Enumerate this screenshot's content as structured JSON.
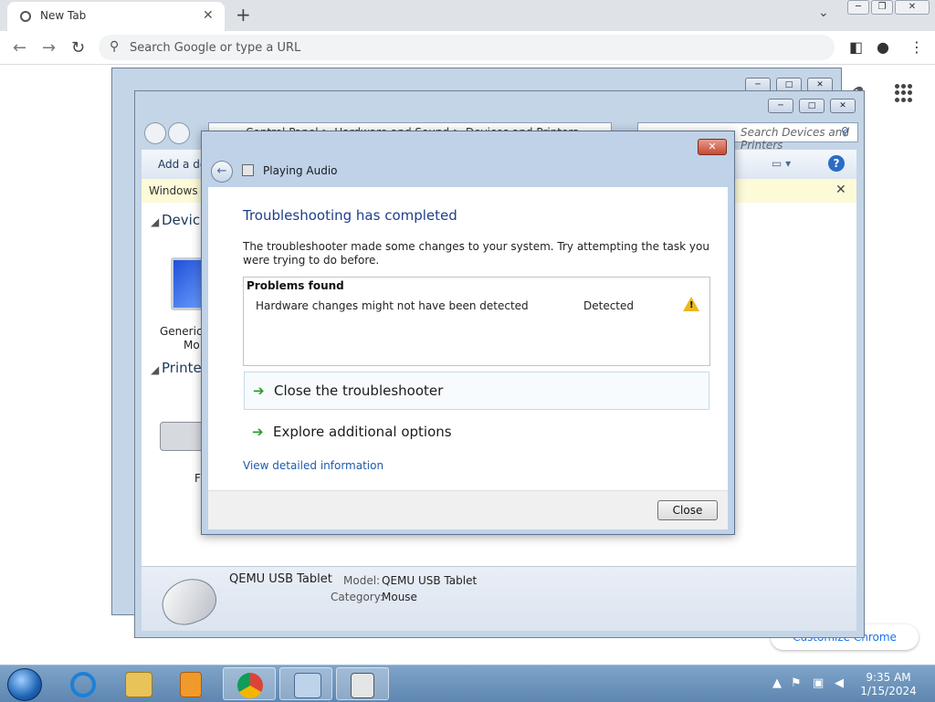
{
  "chrome": {
    "tab_title": "New Tab",
    "omnibox_placeholder": "Search Google or type a URL",
    "customize_label": "Customize Chrome"
  },
  "control_panel": {
    "address": "Control Panel > Hardware and Sound > Devices and Printers",
    "search_placeholder": "Search Devices and Printers",
    "add_device": "Add a de",
    "infobar_text": "Windows c",
    "group_devices": "Device",
    "group_printers": "Printer",
    "device_label_1": "Generic I",
    "device_label_2": "Mo",
    "printer_label": "F",
    "details": {
      "name": "QEMU USB Tablet",
      "model_key": "Model:",
      "model_value": "QEMU USB Tablet",
      "category_key": "Category:",
      "category_value": "Mouse"
    }
  },
  "dialog": {
    "title": "Playing Audio",
    "heading": "Troubleshooting has completed",
    "description": "The troubleshooter made some changes to your system. Try attempting the task you were trying to do before.",
    "problems_header": "Problems found",
    "problems": [
      {
        "text": "Hardware changes might not have been detected",
        "status": "Detected"
      }
    ],
    "options": [
      {
        "label": "Close the troubleshooter"
      },
      {
        "label": "Explore additional options"
      }
    ],
    "details_link": "View detailed information",
    "close_button": "Close"
  },
  "taskbar": {
    "time": "9:35 AM",
    "date": "1/15/2024",
    "colors": {
      "ie": "#1e7fd6",
      "explorer": "#e8c35a",
      "media": "#f09a2b",
      "chrome_red": "#db4437",
      "chrome_yellow": "#f4b400",
      "chrome_green": "#0f9d58"
    }
  }
}
